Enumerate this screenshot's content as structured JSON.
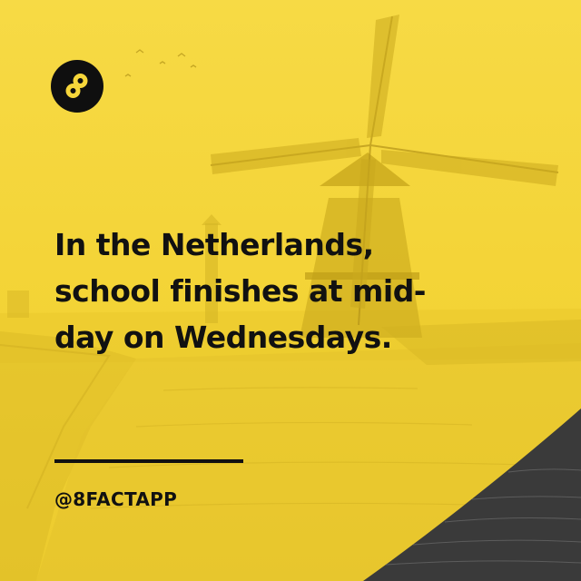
{
  "brand": {
    "logo_icon": "infinity-eight-icon",
    "handle": "@8FACTAPP"
  },
  "fact": {
    "lines": [
      "In the Netherlands,",
      "school finishes at mid-",
      "day on Wednesdays."
    ]
  },
  "background": {
    "scene": "windmill-landscape",
    "tint_color": "#f6d63a",
    "water_color": "#3a3a3a"
  }
}
